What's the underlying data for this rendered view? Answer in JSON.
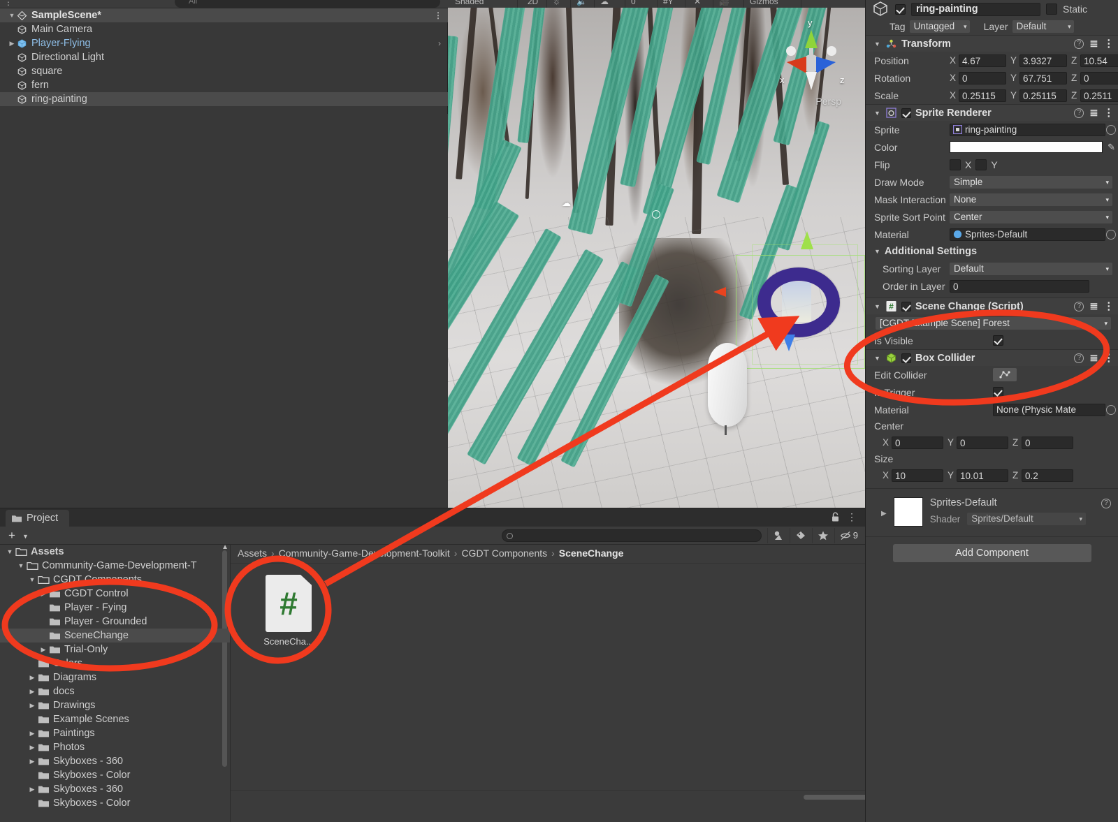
{
  "hierarchy": {
    "search_placeholder": "All",
    "scene_name": "SampleScene*",
    "objects": [
      {
        "label": "Main Camera",
        "selected": false,
        "expandable": false,
        "highlight": false
      },
      {
        "label": "Player-Flying",
        "selected": false,
        "expandable": true,
        "highlight": true
      },
      {
        "label": "Directional Light",
        "selected": false,
        "expandable": false,
        "highlight": false
      },
      {
        "label": "square",
        "selected": false,
        "expandable": false,
        "highlight": false
      },
      {
        "label": "fern",
        "selected": false,
        "expandable": false,
        "highlight": false
      },
      {
        "label": "ring-painting",
        "selected": true,
        "expandable": false,
        "highlight": false
      }
    ]
  },
  "scene_view": {
    "shading_mode": "Shaded",
    "dimension_toggle": "2D",
    "gizmos_label": "Gizmos",
    "hidden_count": "0",
    "axis_x": "x",
    "axis_y": "y",
    "axis_z": "z",
    "perspective_label": "Persp"
  },
  "project": {
    "tab_label": "Project",
    "search_placeholder": "",
    "hidden_assets_count": "9",
    "breadcrumb": [
      "Assets",
      "Community-Game-Development-Toolkit",
      "CGDT Components",
      "SceneChange"
    ],
    "tree": [
      {
        "label": "Assets",
        "depth": 0,
        "twirl": "open",
        "selected": false,
        "bold": true
      },
      {
        "label": "Community-Game-Development-T",
        "depth": 1,
        "twirl": "open",
        "selected": false,
        "bold": false
      },
      {
        "label": "CGDT Components",
        "depth": 2,
        "twirl": "open",
        "selected": false,
        "bold": false
      },
      {
        "label": "CGDT Control",
        "depth": 3,
        "twirl": "closed",
        "selected": false,
        "bold": false
      },
      {
        "label": "Player - Fying",
        "depth": 3,
        "twirl": "none",
        "selected": false,
        "bold": false
      },
      {
        "label": "Player - Grounded",
        "depth": 3,
        "twirl": "none",
        "selected": false,
        "bold": false
      },
      {
        "label": "SceneChange",
        "depth": 3,
        "twirl": "none",
        "selected": true,
        "bold": false
      },
      {
        "label": "Trial-Only",
        "depth": 3,
        "twirl": "closed",
        "selected": false,
        "bold": false
      },
      {
        "label": "Colors",
        "depth": 2,
        "twirl": "none",
        "selected": false,
        "bold": false
      },
      {
        "label": "Diagrams",
        "depth": 2,
        "twirl": "closed",
        "selected": false,
        "bold": false
      },
      {
        "label": "docs",
        "depth": 2,
        "twirl": "closed",
        "selected": false,
        "bold": false
      },
      {
        "label": "Drawings",
        "depth": 2,
        "twirl": "closed",
        "selected": false,
        "bold": false
      },
      {
        "label": "Example Scenes",
        "depth": 2,
        "twirl": "none",
        "selected": false,
        "bold": false
      },
      {
        "label": "Paintings",
        "depth": 2,
        "twirl": "closed",
        "selected": false,
        "bold": false
      },
      {
        "label": "Photos",
        "depth": 2,
        "twirl": "closed",
        "selected": false,
        "bold": false
      },
      {
        "label": "Skyboxes - 360",
        "depth": 2,
        "twirl": "closed",
        "selected": false,
        "bold": false
      },
      {
        "label": "Skyboxes - Color",
        "depth": 2,
        "twirl": "none",
        "selected": false,
        "bold": false
      },
      {
        "label": "Skyboxes - 360",
        "depth": 2,
        "twirl": "closed",
        "selected": false,
        "bold": false
      },
      {
        "label": "Skyboxes - Color",
        "depth": 2,
        "twirl": "none",
        "selected": false,
        "bold": false
      }
    ],
    "assets": [
      {
        "label": "SceneCha...",
        "type": "csharp-script",
        "glyph": "#"
      }
    ]
  },
  "inspector": {
    "object_name": "ring-painting",
    "object_enabled": true,
    "static_label": "Static",
    "static_checked": false,
    "tag_label": "Tag",
    "tag_value": "Untagged",
    "layer_label": "Layer",
    "layer_value": "Default",
    "transform": {
      "title": "Transform",
      "position_label": "Position",
      "position": {
        "x": "4.67",
        "y": "3.9327",
        "z": "10.54"
      },
      "rotation_label": "Rotation",
      "rotation": {
        "x": "0",
        "y": "67.751",
        "z": "0"
      },
      "scale_label": "Scale",
      "scale": {
        "x": "0.25115",
        "y": "0.25115",
        "z": "0.2511"
      }
    },
    "sprite_renderer": {
      "title": "Sprite Renderer",
      "enabled": true,
      "sprite_label": "Sprite",
      "sprite_value": "ring-painting",
      "color_label": "Color",
      "color_value": "#FFFFFF",
      "flip_label": "Flip",
      "flip_x_label": "X",
      "flip_y_label": "Y",
      "flip_x": false,
      "flip_y": false,
      "draw_mode_label": "Draw Mode",
      "draw_mode_value": "Simple",
      "mask_interaction_label": "Mask Interaction",
      "mask_interaction_value": "None",
      "sprite_sort_point_label": "Sprite Sort Point",
      "sprite_sort_point_value": "Center",
      "material_label": "Material",
      "material_value": "Sprites-Default",
      "additional_settings_label": "Additional Settings",
      "sorting_layer_label": "Sorting Layer",
      "sorting_layer_value": "Default",
      "order_in_layer_label": "Order in Layer",
      "order_in_layer_value": "0"
    },
    "scene_change": {
      "title": "Scene Change (Script)",
      "enabled": true,
      "scene_dropdown_value": "[CGDT Example Scene] Forest",
      "is_visible_label": "Is Visible",
      "is_visible": true
    },
    "box_collider": {
      "title": "Box Collider",
      "enabled": true,
      "edit_collider_label": "Edit Collider",
      "is_trigger_label": "Is Trigger",
      "is_trigger": true,
      "material_label": "Material",
      "material_value": "None (Physic Mate",
      "center_label": "Center",
      "center": {
        "x": "0",
        "y": "0",
        "z": "0"
      },
      "size_label": "Size",
      "size": {
        "x": "10",
        "y": "10.01",
        "z": "0.2"
      }
    },
    "material_preview": {
      "name": "Sprites-Default",
      "shader_label": "Shader",
      "shader_value": "Sprites/Default"
    },
    "add_component_label": "Add Component"
  },
  "annotations": {
    "accent_color": "#F03A1E",
    "shapes": [
      "ellipse-project-tree",
      "ellipse-asset-icon",
      "ellipse-scene-change-component",
      "arrow-asset-to-component"
    ]
  }
}
